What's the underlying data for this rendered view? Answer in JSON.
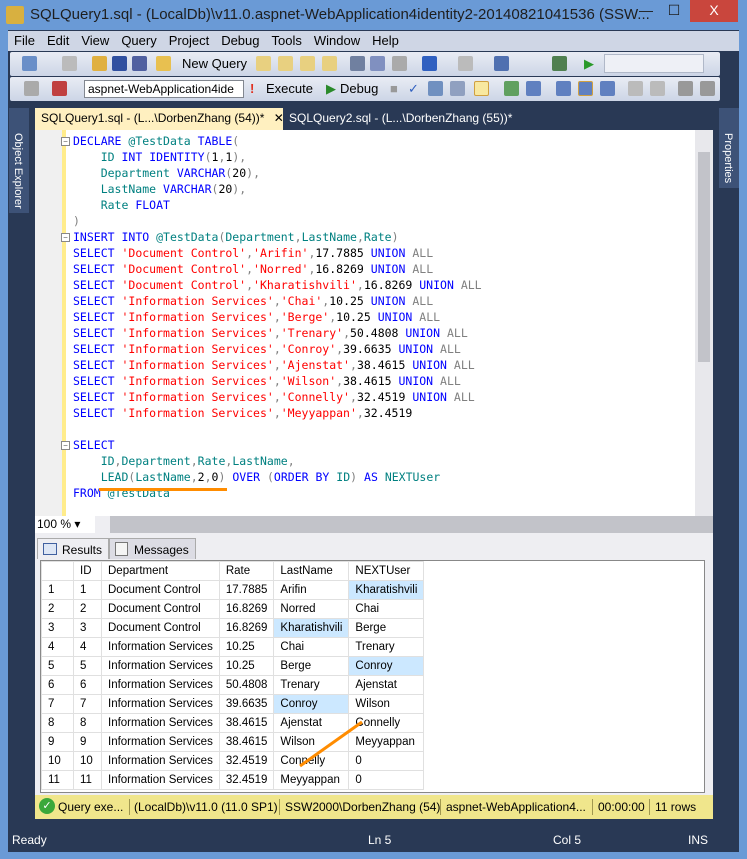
{
  "window": {
    "title": "SQLQuery1.sql - (LocalDb)\\v11.0.aspnet-WebApplication4identity2-20140821041536 (SSW...",
    "minimize": "—",
    "maximize": "☐",
    "close": "X"
  },
  "menu": [
    "File",
    "Edit",
    "View",
    "Query",
    "Project",
    "Debug",
    "Tools",
    "Window",
    "Help"
  ],
  "toolbar": {
    "new_query": "New Query",
    "database": "aspnet-WebApplication4ide",
    "execute": "Execute",
    "debug": "Debug"
  },
  "side": {
    "left": "Object Explorer",
    "right": "Properties"
  },
  "tabs": [
    {
      "label": "SQLQuery1.sql - (L...\\DorbenZhang (54))*",
      "active": true
    },
    {
      "label": "SQLQuery2.sql - (L...\\DorbenZhang (55))*",
      "active": false
    }
  ],
  "editor": {
    "lines": [
      [
        [
          "DECLARE",
          "k"
        ],
        [
          " ",
          "n"
        ],
        [
          "@TestData",
          "i"
        ],
        [
          " ",
          "n"
        ],
        [
          "TABLE",
          "k"
        ],
        [
          "(",
          "p"
        ]
      ],
      [
        [
          "    ID",
          "i"
        ],
        [
          " ",
          "n"
        ],
        [
          "INT",
          "k"
        ],
        [
          " ",
          "n"
        ],
        [
          "IDENTITY",
          "k"
        ],
        [
          "(",
          "p"
        ],
        [
          "1",
          "n"
        ],
        [
          ",",
          "p"
        ],
        [
          "1",
          "n"
        ],
        [
          "),",
          "p"
        ]
      ],
      [
        [
          "    Department",
          "i"
        ],
        [
          " ",
          "n"
        ],
        [
          "VARCHAR",
          "k"
        ],
        [
          "(",
          "p"
        ],
        [
          "20",
          "n"
        ],
        [
          "),",
          "p"
        ]
      ],
      [
        [
          "    LastName",
          "i"
        ],
        [
          " ",
          "n"
        ],
        [
          "VARCHAR",
          "k"
        ],
        [
          "(",
          "p"
        ],
        [
          "20",
          "n"
        ],
        [
          "),",
          "p"
        ]
      ],
      [
        [
          "    Rate",
          "i"
        ],
        [
          " ",
          "n"
        ],
        [
          "FLOAT",
          "k"
        ]
      ],
      [
        [
          ")",
          "p"
        ]
      ],
      [
        [
          "INSERT",
          "k"
        ],
        [
          " ",
          "n"
        ],
        [
          "INTO",
          "k"
        ],
        [
          " ",
          "n"
        ],
        [
          "@TestData",
          "i"
        ],
        [
          "(",
          "p"
        ],
        [
          "Department",
          "i"
        ],
        [
          ",",
          "p"
        ],
        [
          "LastName",
          "i"
        ],
        [
          ",",
          "p"
        ],
        [
          "Rate",
          "i"
        ],
        [
          ")",
          "p"
        ]
      ],
      [
        [
          "SELECT",
          "k"
        ],
        [
          " ",
          "n"
        ],
        [
          "'Document Control'",
          "s"
        ],
        [
          ",",
          "p"
        ],
        [
          "'Arifin'",
          "s"
        ],
        [
          ",",
          "p"
        ],
        [
          "17.7885",
          "n"
        ],
        [
          " ",
          "n"
        ],
        [
          "UNION",
          "k"
        ],
        [
          " ",
          "n"
        ],
        [
          "ALL",
          "g"
        ]
      ],
      [
        [
          "SELECT",
          "k"
        ],
        [
          " ",
          "n"
        ],
        [
          "'Document Control'",
          "s"
        ],
        [
          ",",
          "p"
        ],
        [
          "'Norred'",
          "s"
        ],
        [
          ",",
          "p"
        ],
        [
          "16.8269",
          "n"
        ],
        [
          " ",
          "n"
        ],
        [
          "UNION",
          "k"
        ],
        [
          " ",
          "n"
        ],
        [
          "ALL",
          "g"
        ]
      ],
      [
        [
          "SELECT",
          "k"
        ],
        [
          " ",
          "n"
        ],
        [
          "'Document Control'",
          "s"
        ],
        [
          ",",
          "p"
        ],
        [
          "'Kharatishvili'",
          "s"
        ],
        [
          ",",
          "p"
        ],
        [
          "16.8269",
          "n"
        ],
        [
          " ",
          "n"
        ],
        [
          "UNION",
          "k"
        ],
        [
          " ",
          "n"
        ],
        [
          "ALL",
          "g"
        ]
      ],
      [
        [
          "SELECT",
          "k"
        ],
        [
          " ",
          "n"
        ],
        [
          "'Information Services'",
          "s"
        ],
        [
          ",",
          "p"
        ],
        [
          "'Chai'",
          "s"
        ],
        [
          ",",
          "p"
        ],
        [
          "10.25",
          "n"
        ],
        [
          " ",
          "n"
        ],
        [
          "UNION",
          "k"
        ],
        [
          " ",
          "n"
        ],
        [
          "ALL",
          "g"
        ]
      ],
      [
        [
          "SELECT",
          "k"
        ],
        [
          " ",
          "n"
        ],
        [
          "'Information Services'",
          "s"
        ],
        [
          ",",
          "p"
        ],
        [
          "'Berge'",
          "s"
        ],
        [
          ",",
          "p"
        ],
        [
          "10.25",
          "n"
        ],
        [
          " ",
          "n"
        ],
        [
          "UNION",
          "k"
        ],
        [
          " ",
          "n"
        ],
        [
          "ALL",
          "g"
        ]
      ],
      [
        [
          "SELECT",
          "k"
        ],
        [
          " ",
          "n"
        ],
        [
          "'Information Services'",
          "s"
        ],
        [
          ",",
          "p"
        ],
        [
          "'Trenary'",
          "s"
        ],
        [
          ",",
          "p"
        ],
        [
          "50.4808",
          "n"
        ],
        [
          " ",
          "n"
        ],
        [
          "UNION",
          "k"
        ],
        [
          " ",
          "n"
        ],
        [
          "ALL",
          "g"
        ]
      ],
      [
        [
          "SELECT",
          "k"
        ],
        [
          " ",
          "n"
        ],
        [
          "'Information Services'",
          "s"
        ],
        [
          ",",
          "p"
        ],
        [
          "'Conroy'",
          "s"
        ],
        [
          ",",
          "p"
        ],
        [
          "39.6635",
          "n"
        ],
        [
          " ",
          "n"
        ],
        [
          "UNION",
          "k"
        ],
        [
          " ",
          "n"
        ],
        [
          "ALL",
          "g"
        ]
      ],
      [
        [
          "SELECT",
          "k"
        ],
        [
          " ",
          "n"
        ],
        [
          "'Information Services'",
          "s"
        ],
        [
          ",",
          "p"
        ],
        [
          "'Ajenstat'",
          "s"
        ],
        [
          ",",
          "p"
        ],
        [
          "38.4615",
          "n"
        ],
        [
          " ",
          "n"
        ],
        [
          "UNION",
          "k"
        ],
        [
          " ",
          "n"
        ],
        [
          "ALL",
          "g"
        ]
      ],
      [
        [
          "SELECT",
          "k"
        ],
        [
          " ",
          "n"
        ],
        [
          "'Information Services'",
          "s"
        ],
        [
          ",",
          "p"
        ],
        [
          "'Wilson'",
          "s"
        ],
        [
          ",",
          "p"
        ],
        [
          "38.4615",
          "n"
        ],
        [
          " ",
          "n"
        ],
        [
          "UNION",
          "k"
        ],
        [
          " ",
          "n"
        ],
        [
          "ALL",
          "g"
        ]
      ],
      [
        [
          "SELECT",
          "k"
        ],
        [
          " ",
          "n"
        ],
        [
          "'Information Services'",
          "s"
        ],
        [
          ",",
          "p"
        ],
        [
          "'Connelly'",
          "s"
        ],
        [
          ",",
          "p"
        ],
        [
          "32.4519",
          "n"
        ],
        [
          " ",
          "n"
        ],
        [
          "UNION",
          "k"
        ],
        [
          " ",
          "n"
        ],
        [
          "ALL",
          "g"
        ]
      ],
      [
        [
          "SELECT",
          "k"
        ],
        [
          " ",
          "n"
        ],
        [
          "'Information Services'",
          "s"
        ],
        [
          ",",
          "p"
        ],
        [
          "'Meyyappan'",
          "s"
        ],
        [
          ",",
          "p"
        ],
        [
          "32.4519",
          "n"
        ]
      ],
      [
        [
          " ",
          "n"
        ]
      ],
      [
        [
          "SELECT",
          "k"
        ]
      ],
      [
        [
          "    ID",
          "i"
        ],
        [
          ",",
          "p"
        ],
        [
          "Department",
          "i"
        ],
        [
          ",",
          "p"
        ],
        [
          "Rate",
          "i"
        ],
        [
          ",",
          "p"
        ],
        [
          "LastName",
          "i"
        ],
        [
          ",",
          "p"
        ]
      ],
      [
        [
          "    LEAD",
          "i"
        ],
        [
          "(",
          "p"
        ],
        [
          "LastName",
          "i"
        ],
        [
          ",",
          "p"
        ],
        [
          "2",
          "n"
        ],
        [
          ",",
          "p"
        ],
        [
          "0",
          "n"
        ],
        [
          ")",
          "p"
        ],
        [
          " ",
          "n"
        ],
        [
          "OVER",
          "k"
        ],
        [
          " ",
          "n"
        ],
        [
          "(",
          "p"
        ],
        [
          "ORDER",
          "k"
        ],
        [
          " ",
          "n"
        ],
        [
          "BY",
          "k"
        ],
        [
          " ",
          "n"
        ],
        [
          "ID",
          "i"
        ],
        [
          ")",
          "p"
        ],
        [
          " ",
          "n"
        ],
        [
          "AS",
          "k"
        ],
        [
          " ",
          "n"
        ],
        [
          "NEXTUser",
          "i"
        ]
      ],
      [
        [
          "FROM",
          "k"
        ],
        [
          " ",
          "n"
        ],
        [
          "@TestData",
          "i"
        ]
      ]
    ]
  },
  "zoom": "100 %",
  "results_tabs": [
    "Results",
    "Messages"
  ],
  "grid": {
    "columns": [
      "",
      "ID",
      "Department",
      "Rate",
      "LastName",
      "NEXTUser"
    ],
    "rows": [
      [
        "1",
        "1",
        "Document Control",
        "17.7885",
        "Arifin",
        "Kharatishvili"
      ],
      [
        "2",
        "2",
        "Document Control",
        "16.8269",
        "Norred",
        "Chai"
      ],
      [
        "3",
        "3",
        "Document Control",
        "16.8269",
        "Kharatishvili",
        "Berge"
      ],
      [
        "4",
        "4",
        "Information Services",
        "10.25",
        "Chai",
        "Trenary"
      ],
      [
        "5",
        "5",
        "Information Services",
        "10.25",
        "Berge",
        "Conroy"
      ],
      [
        "6",
        "6",
        "Information Services",
        "50.4808",
        "Trenary",
        "Ajenstat"
      ],
      [
        "7",
        "7",
        "Information Services",
        "39.6635",
        "Conroy",
        "Wilson"
      ],
      [
        "8",
        "8",
        "Information Services",
        "38.4615",
        "Ajenstat",
        "Connelly"
      ],
      [
        "9",
        "9",
        "Information Services",
        "38.4615",
        "Wilson",
        "Meyyappan"
      ],
      [
        "10",
        "10",
        "Information Services",
        "32.4519",
        "Connelly",
        "0"
      ],
      [
        "11",
        "11",
        "Information Services",
        "32.4519",
        "Meyyappan",
        "0"
      ]
    ],
    "highlighted": [
      [
        0,
        5
      ],
      [
        2,
        4
      ],
      [
        4,
        5
      ],
      [
        6,
        4
      ]
    ]
  },
  "query_status": {
    "message": "Query exe...",
    "server": "(LocalDb)\\v11.0 (11.0 SP1)",
    "user": "SSW2000\\DorbenZhang (54)",
    "database": "aspnet-WebApplication4...",
    "time": "00:00:00",
    "rows": "11 rows"
  },
  "statusbar": {
    "state": "Ready",
    "line": "Ln 5",
    "col": "Col 5",
    "mode": "INS"
  },
  "colors": {
    "accent": "#293955",
    "annotation": "#ff8c00",
    "highlight": "#cce8ff",
    "status_bg": "#f0e68c"
  }
}
